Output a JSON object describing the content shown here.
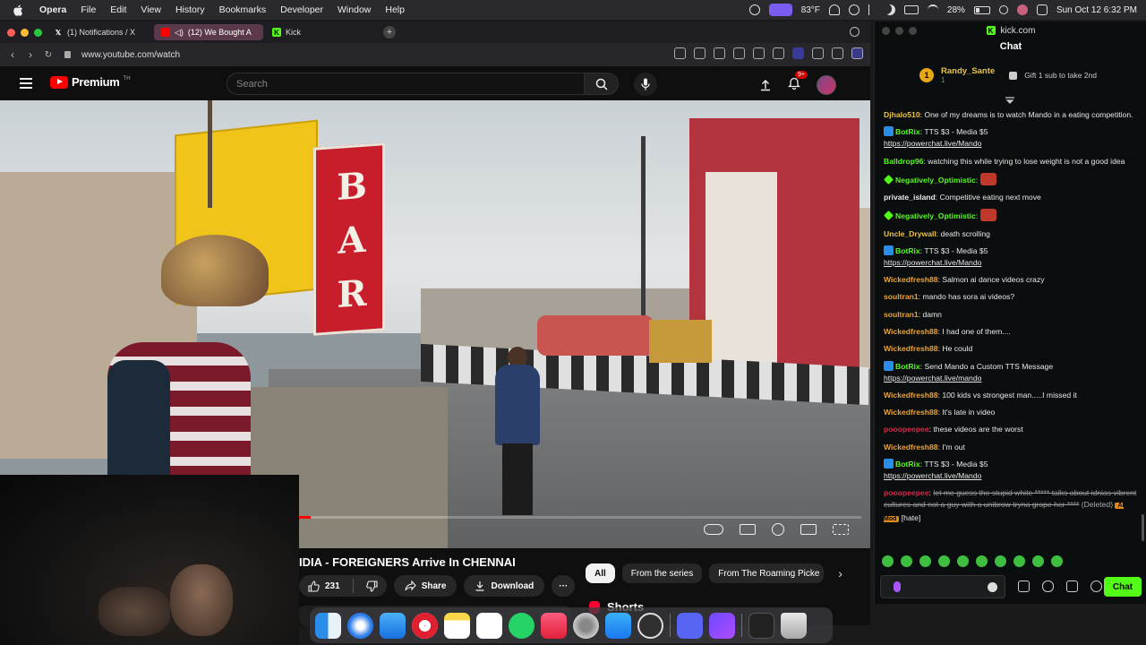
{
  "menubar": {
    "app": "Opera",
    "items": [
      "File",
      "Edit",
      "View",
      "History",
      "Bookmarks",
      "Developer",
      "Window",
      "Help"
    ],
    "weather": "83°F",
    "battery": "28%",
    "datetime": "Sun Oct 12  6:32 PM"
  },
  "browser": {
    "tabs": [
      {
        "label": "(1) Notifications / X",
        "icon": "x-logo-icon"
      },
      {
        "label": "(12) We Bought A",
        "icon": "youtube-icon"
      },
      {
        "label": "Kick",
        "icon": "kick-icon"
      }
    ],
    "url": "www.youtube.com/watch"
  },
  "youtube": {
    "logo": "Premium",
    "logo_tm": "TH",
    "search_placeholder": "Search",
    "notif_badge": "9+",
    "video_title": "IDIA - FOREIGNERS Arrive In CHENNAI",
    "likes": "231",
    "share_label": "Share",
    "download_label": "Download",
    "more_label": "···",
    "chips": [
      "All",
      "From the series",
      "From The Roaming Picke"
    ],
    "shorts_label": "Shorts",
    "progress": 0.02,
    "video_sign_letters": [
      "B",
      "A",
      "R"
    ]
  },
  "kick": {
    "window_title": "kick.com",
    "chat_title": "Chat",
    "pinned": {
      "rank": "1",
      "user": "Randy_Sante",
      "count": "1",
      "text": "Gift 1 sub to take 2nd"
    },
    "messages": [
      {
        "user": "Djhalo510",
        "color": "#e8c34a",
        "text": "One of my dreams is to watch Mando in a eating competition."
      },
      {
        "user": "BotRix",
        "color": "#53fc18",
        "badges": [
          "bot"
        ],
        "text": "TTS $3 - Media $5",
        "link": "https://powerchat.live/Mando"
      },
      {
        "user": "Balldrop96",
        "color": "#53fc18",
        "text": "watching this while trying to lose weight is not a good idea"
      },
      {
        "user": "Negatively_Optimistic",
        "color": "#53fc18",
        "badges": [
          "star"
        ],
        "text": ""
      },
      {
        "user": "private_island",
        "color": "#e8e8e8",
        "text": "Competitive eating next move"
      },
      {
        "user": "Negatively_Optimistic",
        "color": "#53fc18",
        "badges": [
          "star"
        ],
        "text": ""
      },
      {
        "user": "Uncle_Drywall",
        "color": "#e8c34a",
        "text": "death scrolling"
      },
      {
        "user": "BotRix",
        "color": "#53fc18",
        "badges": [
          "bot"
        ],
        "text": "TTS $3 - Media $5",
        "link": "https://powerchat.live/Mando"
      },
      {
        "user": "Wickedfresh88",
        "color": "#e8a23a",
        "text": "Salmon ai dance videos crazy"
      },
      {
        "user": "soultran1",
        "color": "#e8a23a",
        "text": "mando has sora ai videos?"
      },
      {
        "user": "soultran1",
        "color": "#e8a23a",
        "text": "damn"
      },
      {
        "user": "Wickedfresh88",
        "color": "#e8a23a",
        "text": "I had one of them...."
      },
      {
        "user": "Wickedfresh88",
        "color": "#e8a23a",
        "text": "He could"
      },
      {
        "user": "BotRix",
        "color": "#53fc18",
        "badges": [
          "bot"
        ],
        "text": "Send Mando a Custom TTS Message",
        "link": "https://powerchat.live/mando"
      },
      {
        "user": "Wickedfresh88",
        "color": "#e8a23a",
        "text": "100 kids vs strongest man.....I missed it"
      },
      {
        "user": "Wickedfresh88",
        "color": "#e8a23a",
        "text": "It's late in video"
      },
      {
        "user": "pooopeepee",
        "color": "#d6284a",
        "text": "these videos are the worst"
      },
      {
        "user": "Wickedfresh88",
        "color": "#e8a23a",
        "text": "I'm out"
      },
      {
        "user": "BotRix",
        "color": "#53fc18",
        "badges": [
          "bot"
        ],
        "text": "TTS $3 - Media $5",
        "link": "https://powerchat.live/Mando"
      },
      {
        "user": "pooopeepee",
        "color": "#d6284a",
        "struck": "let me guess the stupid white ***** talks about idnias vibrent cultures and not a guy with a unibrow tryna grope her ****",
        "deleted": "(Deleted)",
        "aimod": "AI Mod",
        "tag": "[hate]"
      }
    ],
    "chat_button": "Chat"
  },
  "colors": {
    "kick_green": "#53fc18",
    "yt_red": "#ff0000",
    "bg": "#0f0f0f"
  }
}
